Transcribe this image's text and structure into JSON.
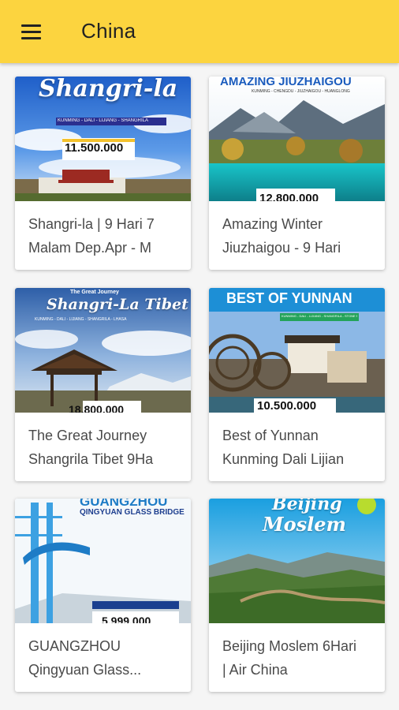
{
  "header": {
    "title": "China",
    "menu_icon": "hamburger-menu-icon",
    "background": "#fcd43f"
  },
  "cards": [
    {
      "label_line1": "Shangri-la | 9 Hari 7",
      "label_line2": "Malam Dep.Apr - M",
      "poster_title": "Shangri-la",
      "poster_route": "KUNMING - DALI - LIJIANG - SHANGRILA",
      "poster_price": "11.500.000"
    },
    {
      "label_line1": "Amazing Winter",
      "label_line2": "Jiuzhaigou - 9 Hari",
      "poster_title": "AMAZING JIUZHAIGOU",
      "poster_route": "KUNMING - CHENGDU - JIUZHAIGOU - HUANGLONG",
      "poster_price": "12.800.000"
    },
    {
      "label_line1": "The Great Journey",
      "label_line2": "Shangrila Tibet 9Ha",
      "poster_subtitle": "The Great Journey",
      "poster_title": "Shangri-La Tibet",
      "poster_route": "KUNMING - DALI - LIJIANG - SHANGRILA - LHASA",
      "poster_price": "18.800.000"
    },
    {
      "label_line1": "Best of Yunnan",
      "label_line2": "Kunming Dali Lijian",
      "poster_title": "BEST OF YUNNAN",
      "poster_route": "KUNMING - DALI - LIJIANG - SHANGRILA - STONE FOREST",
      "poster_price": "10.500.000"
    },
    {
      "label_line1": "GUANGZHOU",
      "label_line2": "Qingyuan Glass...",
      "poster_title": "GUANGZHOU",
      "poster_title2": "QINGYUAN GLASS BRIDGE",
      "poster_price": "5.999.000"
    },
    {
      "label_line1": "Beijing Moslem 6Hari",
      "label_line2": "| Air China",
      "poster_title": "Beijing",
      "poster_title2": "Moslem"
    }
  ]
}
